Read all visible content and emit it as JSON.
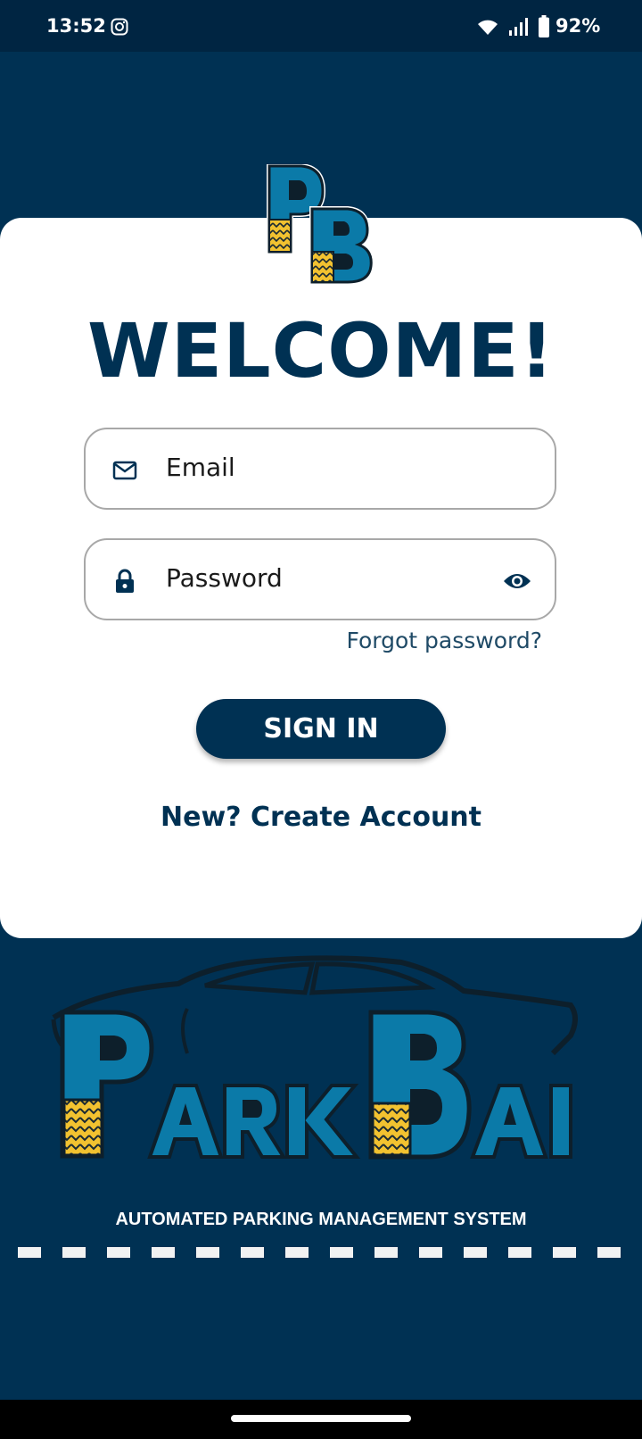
{
  "status_bar": {
    "time": "13:52",
    "battery_percent": "92%",
    "notification_icons": [
      "instagram-icon"
    ],
    "system_icons": [
      "wifi-icon",
      "signal-icon",
      "battery-icon"
    ]
  },
  "login": {
    "title": "WELCOME!",
    "email": {
      "placeholder": "Email",
      "icon": "mail-icon"
    },
    "password": {
      "placeholder": "Password",
      "icon": "lock-icon",
      "toggle_icon": "eye-icon"
    },
    "forgot_link": "Forgot password?",
    "signin_button": "SIGN IN",
    "create_account_link": "New? Create Account"
  },
  "brand": {
    "badge_letters": "PB",
    "wordmark": "PARKBAI",
    "tagline": "AUTOMATED PARKING MANAGEMENT SYSTEM"
  },
  "colors": {
    "primary": "#003153",
    "accent_blue": "#0b7aa8",
    "accent_yellow": "#f2c230",
    "card_background": "#ffffff"
  }
}
